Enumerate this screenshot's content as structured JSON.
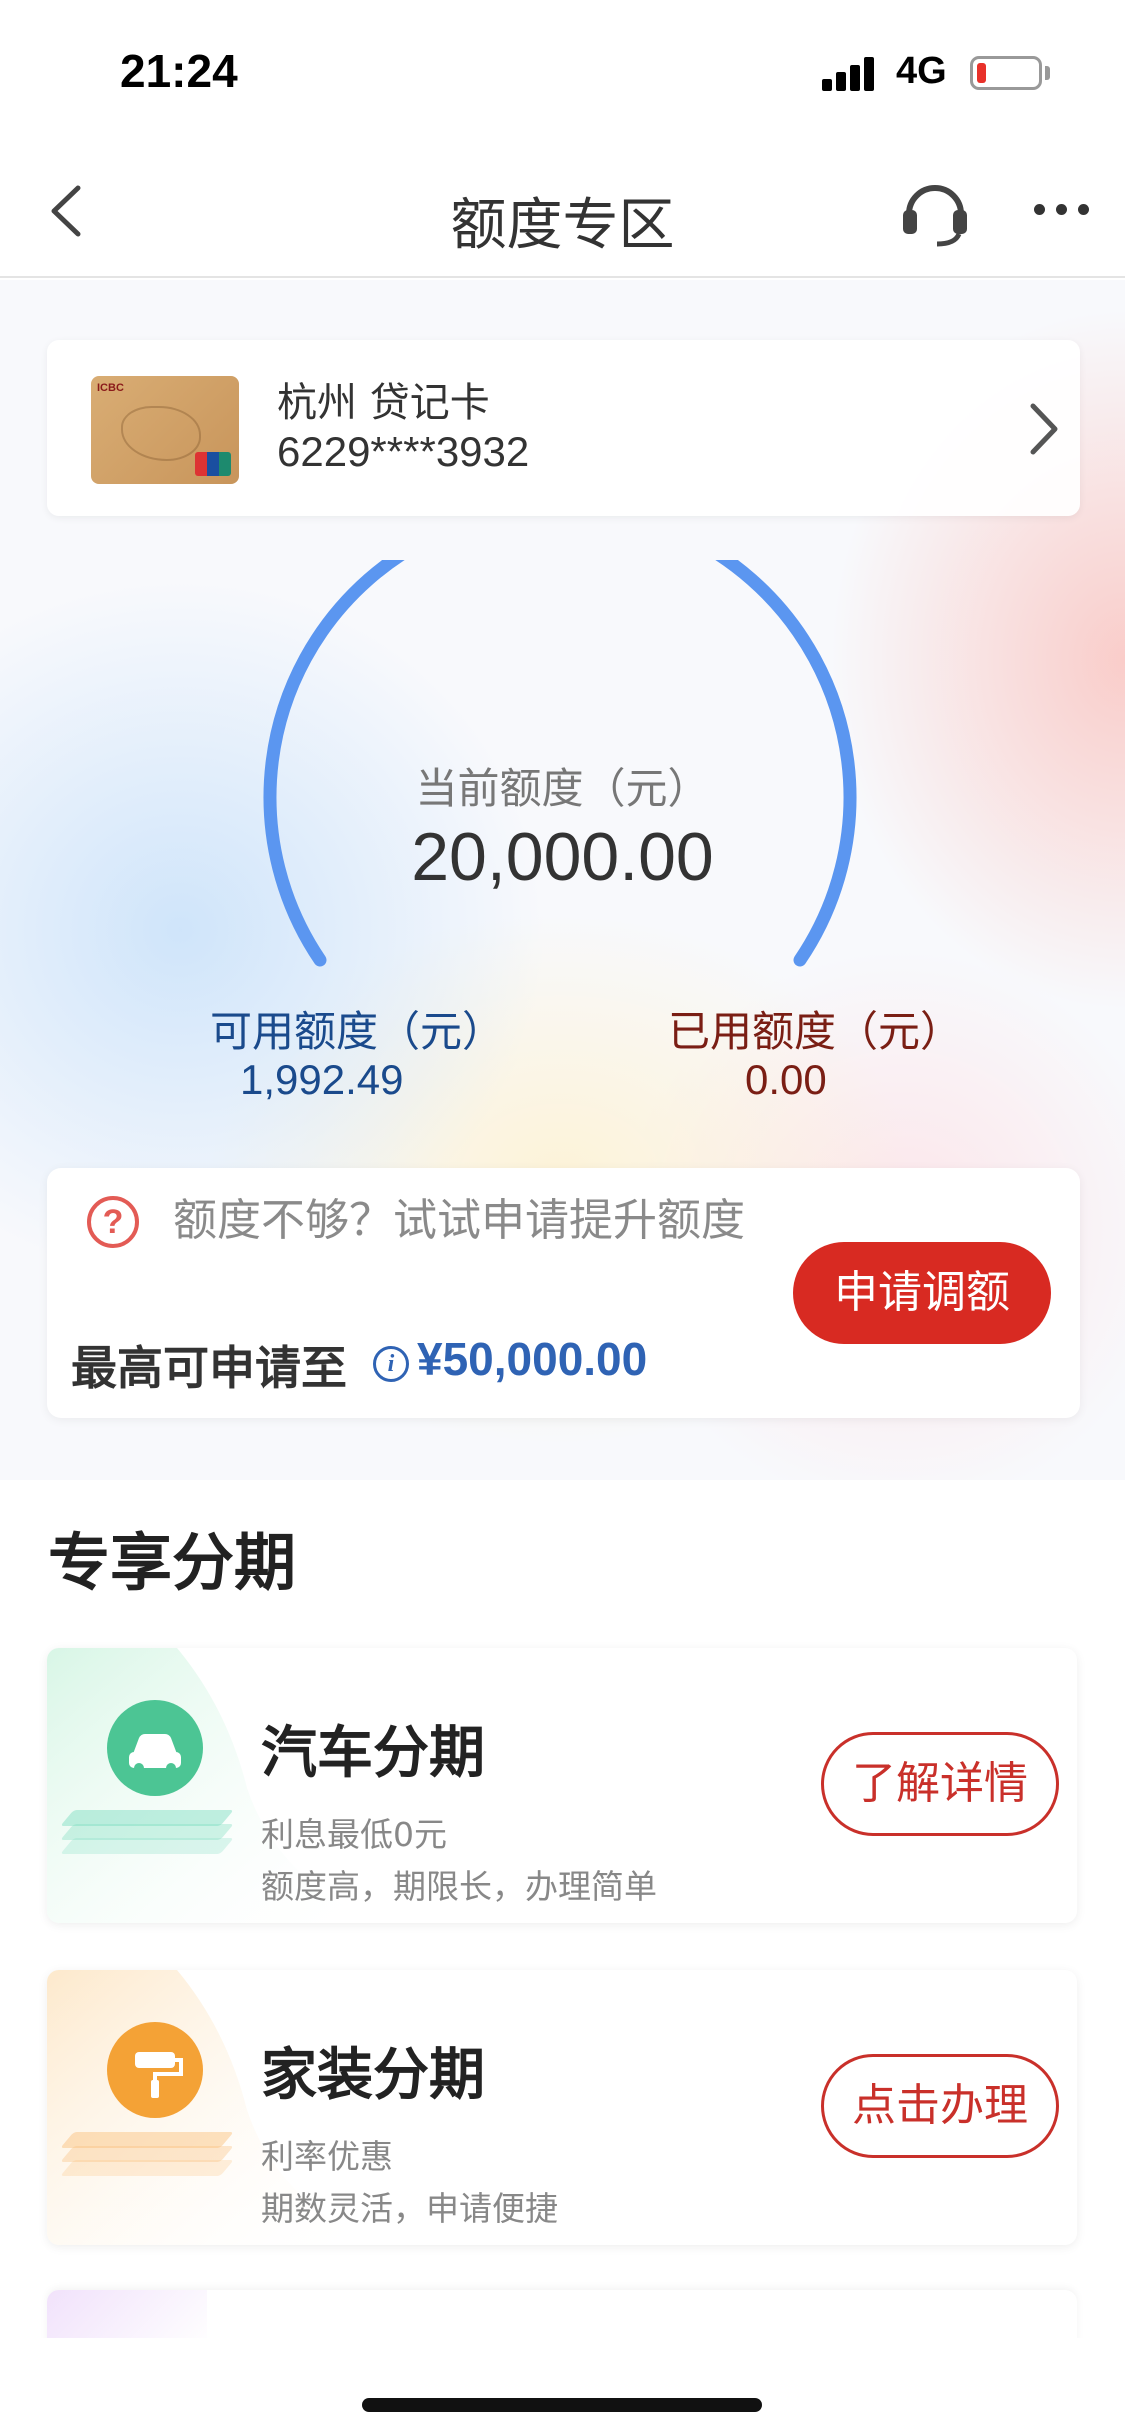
{
  "status_bar": {
    "time": "21:24",
    "network": "4G",
    "battery_color": "#e8312a"
  },
  "nav": {
    "title": "额度专区",
    "back_icon": "chevron-left-icon",
    "service_icon": "headset-icon",
    "more_icon": "more-dots-icon"
  },
  "card": {
    "name": "杭州 贷记卡",
    "number": "6229****3932"
  },
  "gauge": {
    "caption": "当前额度（元）",
    "value": "20,000.00",
    "arc_color": "#5b96f0"
  },
  "available": {
    "label": "可用额度（元）",
    "value": "1,992.49"
  },
  "used": {
    "label": "已用额度（元）",
    "value": "0.00"
  },
  "raise": {
    "prompt": "额度不够？试试申请提升额度",
    "max_label": "最高可申请至",
    "max_value": "¥50,000.00",
    "button_label": "申请调额",
    "accent": "#d82a22"
  },
  "section": {
    "title": "专享分期"
  },
  "promos": [
    {
      "title": "汽车分期",
      "sub1": "利息最低0元",
      "sub2": "额度高，期限长，办理简单",
      "button_label": "了解详情",
      "icon": "car-icon",
      "icon_color": "#4cc594"
    },
    {
      "title": "家装分期",
      "sub1": "利率优惠",
      "sub2": "期数灵活，申请便捷",
      "button_label": "点击办理",
      "icon": "paint-roller-icon",
      "icon_color": "#f4a236"
    }
  ]
}
